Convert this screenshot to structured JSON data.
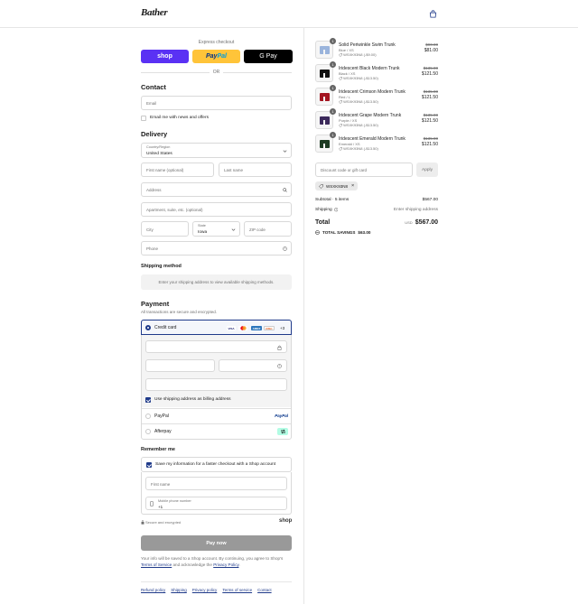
{
  "header": {
    "logo": "Bather",
    "cart_icon": "shopping-bag-icon"
  },
  "express": {
    "label": "Express checkout",
    "shop": "shop",
    "paypal_a": "Pay",
    "paypal_b": "Pal",
    "gpay": "G Pay",
    "or": "OR"
  },
  "contact": {
    "heading": "Contact",
    "email_placeholder": "Email",
    "newsletter_label": "Email me with news and offers"
  },
  "delivery": {
    "heading": "Delivery",
    "country_label": "Country/Region",
    "country_value": "United States",
    "first_name": "First name (optional)",
    "last_name": "Last name",
    "address": "Address",
    "apartment": "Apartment, suite, etc. (optional)",
    "city": "City",
    "state_label": "State",
    "state_value": "Iowa",
    "zip": "ZIP code",
    "phone": "Phone"
  },
  "shipping_method": {
    "heading": "Shipping method",
    "notice": "Enter your shipping address to view available shipping methods."
  },
  "payment": {
    "heading": "Payment",
    "subtitle": "All transactions are secure and encrypted.",
    "credit_card": "Credit card",
    "card_logos": [
      "VISA",
      "MC",
      "AMEX",
      "DISC"
    ],
    "more_cards": "+3",
    "billing_label": "Use shipping address as billing address",
    "paypal": "PayPal",
    "paypal_logo": "PayPal",
    "afterpay": "Afterpay"
  },
  "remember": {
    "heading": "Remember me",
    "save_label": "Save my information for a faster checkout with a Shop account",
    "first_name": "First name",
    "phone_label": "Mobile phone number",
    "phone_value": "+1",
    "secure": "Secure and encrypted",
    "shop": "shop"
  },
  "pay_now": "Pay now",
  "legal": {
    "text_1": "Your info will be saved to a Shop account. By continuing, you agree to Shop's",
    "terms": "Terms of Service",
    "and": " and acknowledge the ",
    "privacy": "Privacy Policy",
    "end": "."
  },
  "footer": [
    "Refund policy",
    "Shipping",
    "Privacy policy",
    "Terms of service",
    "Contact"
  ],
  "cart": {
    "items": [
      {
        "qty": "1",
        "name": "Solid Periwinkle Swim Trunk",
        "variant": "Blue / XS",
        "discount": "WSXK93N8 (-$9.00)",
        "old": "$90.00",
        "price": "$81.00",
        "color": "#9ab4dc"
      },
      {
        "qty": "1",
        "name": "Iridescent Black Modern Trunk",
        "variant": "Black / XS",
        "discount": "WSXK93N8 (-$13.50)",
        "old": "$135.00",
        "price": "$121.50",
        "color": "#111111"
      },
      {
        "qty": "1",
        "name": "Iridescent Crimson Modern Trunk",
        "variant": "Red / L",
        "discount": "WSXK93N8 (-$13.50)",
        "old": "$135.00",
        "price": "$121.50",
        "color": "#a31420"
      },
      {
        "qty": "1",
        "name": "Iridescent Grape Modern Trunk",
        "variant": "Purple / XS",
        "discount": "WSXK93N8 (-$13.50)",
        "old": "$135.00",
        "price": "$121.50",
        "color": "#3c2a5c"
      },
      {
        "qty": "1",
        "name": "Iridescent Emerald Modern Trunk",
        "variant": "Emerald / XS",
        "discount": "WSXK93N8 (-$13.50)",
        "old": "$135.00",
        "price": "$121.50",
        "color": "#1d3b22"
      }
    ],
    "discount_placeholder": "Discount code or gift card",
    "apply": "Apply",
    "applied_code": "WSXK93N8",
    "subtotal_label": "Subtotal · 5 items",
    "subtotal_value": "$567.00",
    "shipping_label": "Shipping",
    "shipping_value": "Enter shipping address",
    "total_label": "Total",
    "currency": "USD",
    "total_value": "$567.00",
    "savings_label": "TOTAL SAVINGS",
    "savings_value": "$63.00"
  }
}
